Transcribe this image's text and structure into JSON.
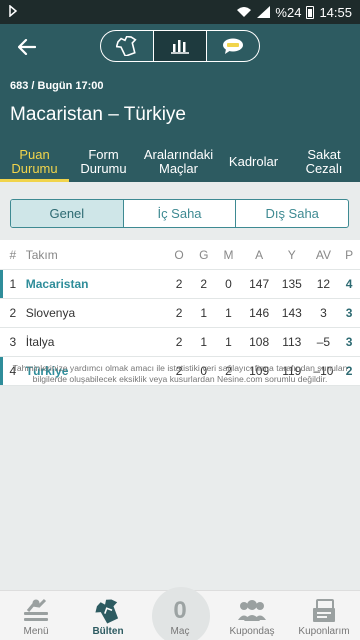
{
  "status": {
    "battery": "%24",
    "time": "14:55"
  },
  "header": {
    "match_info": "683 / Bugün 17:00",
    "match_title": "Macaristan – Türkiye"
  },
  "segment_icons": [
    "jersey-icon",
    "stats-chart-icon",
    "chat-icon"
  ],
  "tabs": [
    {
      "label": "Puan Durumu",
      "active": true
    },
    {
      "label": "Form Durumu",
      "active": false
    },
    {
      "label": "Aralarındaki Maçlar",
      "active": false
    },
    {
      "label": "Kadrolar",
      "active": false
    },
    {
      "label": "Sakat Cezalı",
      "active": false
    }
  ],
  "filters": [
    {
      "label": "Genel",
      "active": true
    },
    {
      "label": "İç Saha",
      "active": false
    },
    {
      "label": "Dış Saha",
      "active": false
    }
  ],
  "table": {
    "headers": {
      "num": "#",
      "team": "Takım",
      "o": "O",
      "g": "G",
      "m": "M",
      "a": "A",
      "y": "Y",
      "av": "AV",
      "p": "P"
    },
    "rows": [
      {
        "num": "1",
        "team": "Macaristan",
        "o": "2",
        "g": "2",
        "m": "0",
        "a": "147",
        "y": "135",
        "av": "12",
        "p": "4",
        "highlight": true
      },
      {
        "num": "2",
        "team": "Slovenya",
        "o": "2",
        "g": "1",
        "m": "1",
        "a": "146",
        "y": "143",
        "av": "3",
        "p": "3",
        "highlight": false
      },
      {
        "num": "3",
        "team": "İtalya",
        "o": "2",
        "g": "1",
        "m": "1",
        "a": "108",
        "y": "113",
        "av": "–5",
        "p": "3",
        "highlight": false
      },
      {
        "num": "4",
        "team": "Türkiye",
        "o": "2",
        "g": "0",
        "m": "2",
        "a": "109",
        "y": "119",
        "av": "–10",
        "p": "2",
        "highlight": true
      }
    ]
  },
  "disclaimer": "Tahminlerinize yardımcı olmak amacı ile istatistiki veri sağlayıcı firma tarafından sunulan bilgilerde oluşabilecek eksiklik veya kusurlardan Nesine.com sorumlu değildir.",
  "bottom_nav": {
    "menu": "Menü",
    "bulten": "Bülten",
    "mac_count": "0",
    "mac": "Maç",
    "kuponodas": "Kupondaş",
    "kuponlarim": "Kuponlarım"
  },
  "colors": {
    "header": "#2d5b61",
    "accent": "#f1d44b",
    "teal": "#2f8d9a"
  }
}
